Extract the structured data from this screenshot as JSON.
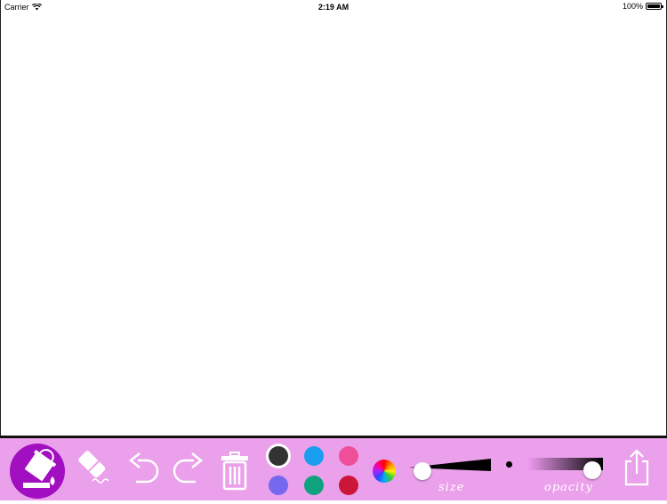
{
  "status_bar": {
    "carrier": "Carrier",
    "time": "2:19 AM",
    "battery": "100%",
    "battery_level": 1.0
  },
  "toolbar": {
    "background_color": "#eaa0ea",
    "tools": [
      {
        "icon": "paint-bucket-icon",
        "selected": true
      },
      {
        "icon": "eraser-icon",
        "selected": false
      },
      {
        "icon": "undo-icon"
      },
      {
        "icon": "redo-icon"
      },
      {
        "icon": "trash-icon"
      }
    ],
    "colors": [
      "#333333",
      "#1a9ef0",
      "#ef4f98",
      "#7468ee",
      "#10a27e",
      "#cc1638"
    ],
    "selected_color": "#333333",
    "color_wheel_icon": "color-wheel-icon",
    "size_label": "size",
    "size_value": 0.07,
    "opacity_label": "opacity",
    "opacity_value": 1.0,
    "share_icon": "share-icon"
  }
}
